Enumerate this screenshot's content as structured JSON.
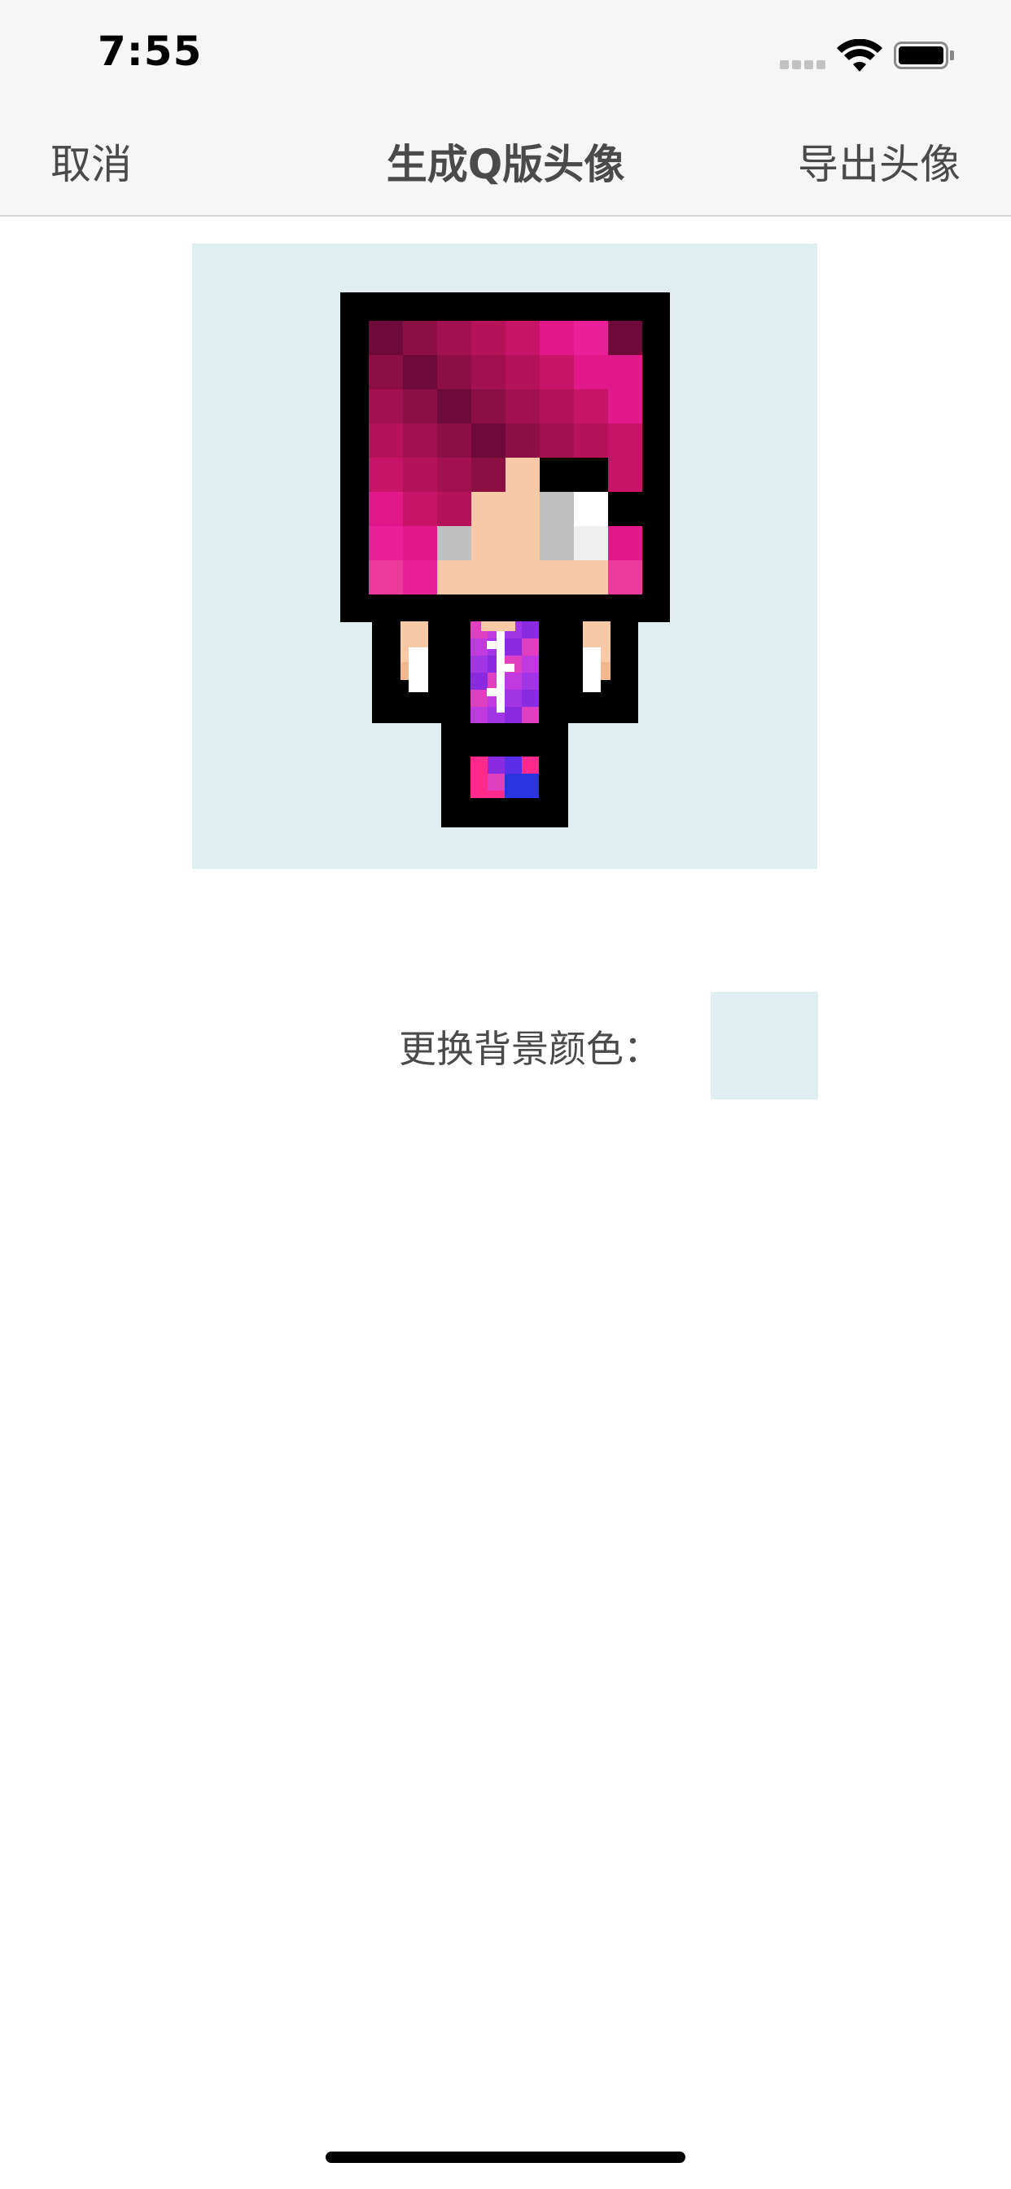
{
  "status_bar": {
    "time": "7:55",
    "signal_icon": "cellular-signal-icon",
    "wifi_icon": "wifi-icon",
    "battery_icon": "battery-full-icon"
  },
  "nav": {
    "cancel_label": "取消",
    "title": "生成Q版头像",
    "export_label": "导出头像"
  },
  "avatar": {
    "background_color": "#e0eef2",
    "pixel_palette": {
      "outline": "#000000",
      "skin": "#f8c9a6",
      "skin_shadow": "#f3b88f",
      "eye_white": "#ffffff",
      "eye_gray": "#c0c0c0",
      "eye_light": "#f0f0f0",
      "hair_dark": "#6e0a3a",
      "hair_mid": "#a3104f",
      "hair_bright": "#e0188a",
      "hair_pink": "#ea3b9c",
      "shirt_purple": "#8a2be2",
      "shirt_magenta": "#e040c0",
      "pants_blue": "#2a35e0",
      "pants_pink": "#ff2a8c"
    }
  },
  "background_picker": {
    "label": "更换背景颜色：",
    "current_color": "#e0eef2"
  }
}
